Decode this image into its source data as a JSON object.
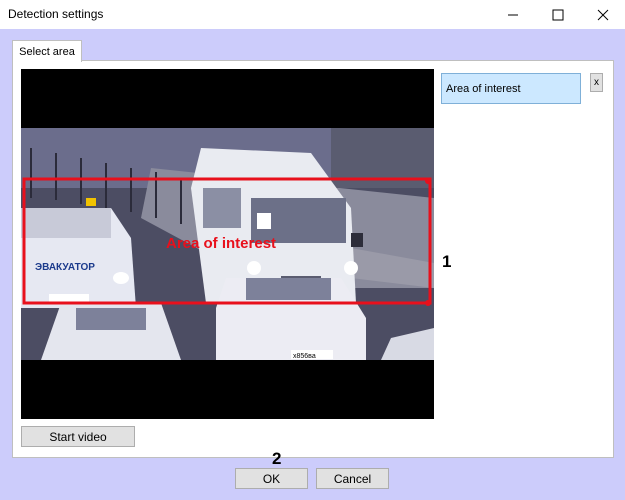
{
  "window": {
    "title": "Detection settings"
  },
  "tabs": [
    {
      "label": "Select area"
    }
  ],
  "video": {
    "overlay_label": "Area of interest",
    "vehicle_text": "ЭВАКУАТОР",
    "plate_text": "х856ва"
  },
  "areas": [
    {
      "name": "Area of interest"
    }
  ],
  "delete_label": "x",
  "start_video_label": "Start video",
  "ok_label": "OK",
  "cancel_label": "Cancel",
  "callouts": {
    "one": "1",
    "two": "2"
  },
  "colors": {
    "region_outline": "#e8101c",
    "selected_row": "#cce8ff"
  }
}
